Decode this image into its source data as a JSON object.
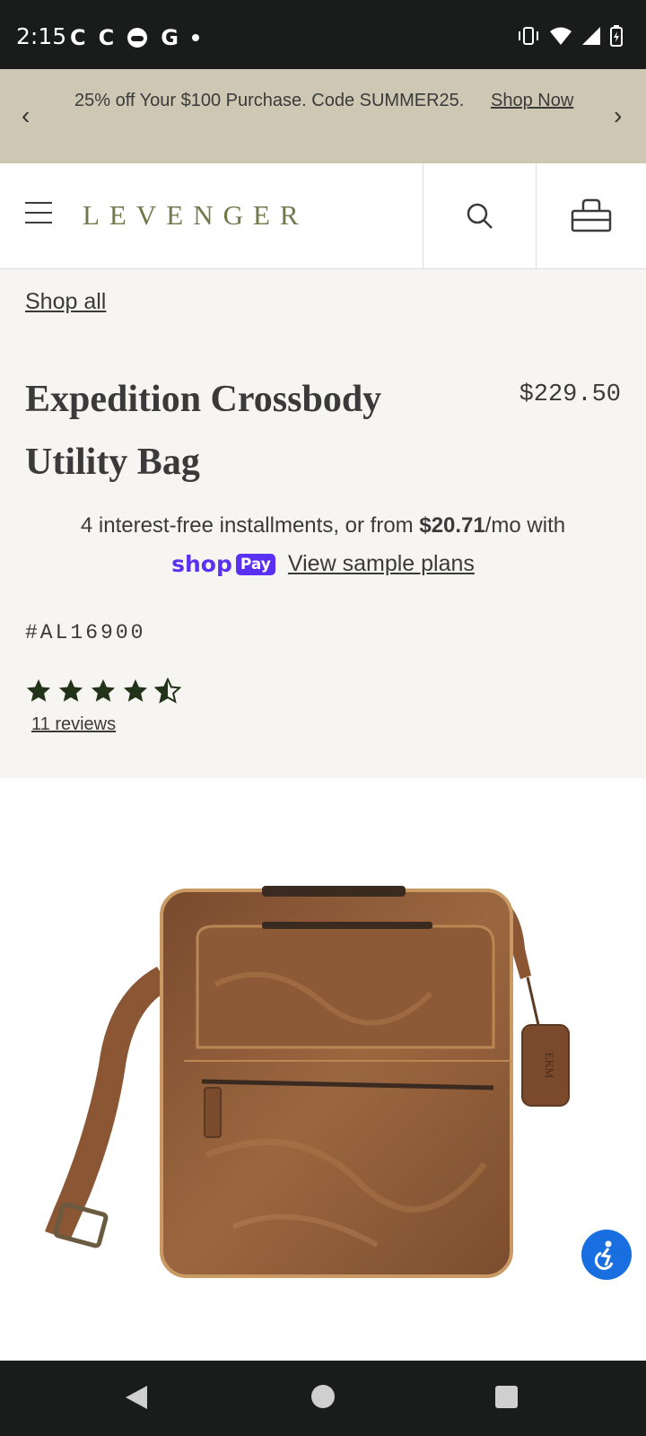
{
  "status": {
    "time": "2:15",
    "left_icons": [
      "C",
      "C",
      "gamepad-icon",
      "G",
      "dot-icon"
    ],
    "right_icons": [
      "vibrate-icon",
      "wifi-icon",
      "signal-icon",
      "battery-icon"
    ]
  },
  "promo": {
    "text": "25% off Your $100 Purchase. Code SUMMER25.",
    "link": "Shop Now",
    "prev": "‹",
    "next": "›"
  },
  "header": {
    "logo": "LEVENGER",
    "icons": [
      "menu-icon",
      "search-icon",
      "bag-icon"
    ]
  },
  "product": {
    "breadcrumb": "Shop all",
    "title": "Expedition Crossbody Utility Bag",
    "price": "$229.50",
    "installments_prefix": "4 interest-free installments, or from ",
    "installments_amount": "$20.71",
    "installments_suffix": "/mo with",
    "shoppay_shop": "shop",
    "shoppay_pay": "Pay",
    "view_plans": "View sample plans",
    "sku": "#AL16900",
    "rating": 4.5,
    "rating_max": 5,
    "reviews": "11 reviews",
    "tag_monogram": "EKM"
  },
  "colors": {
    "promo_bg": "#cdc7b3",
    "logo": "#6f7a4b",
    "star": "#22331a",
    "shoppay": "#5a31f4",
    "accessibility": "#1a6fe0"
  }
}
